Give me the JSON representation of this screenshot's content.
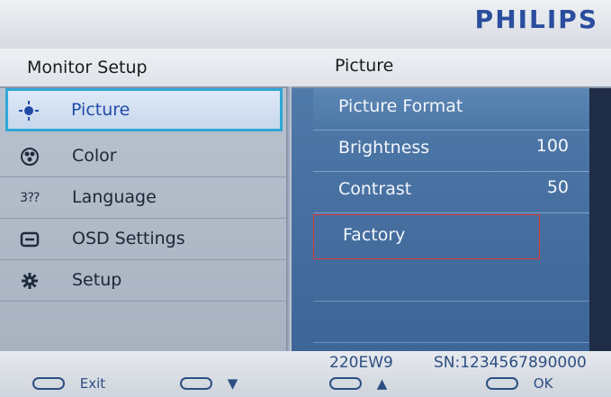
{
  "brand": "PHILIPS",
  "header": {
    "left_title": "Monitor Setup",
    "right_title": "Picture"
  },
  "menu": [
    {
      "label": "Picture",
      "icon": "picture-icon",
      "selected": true
    },
    {
      "label": "Color",
      "icon": "color-icon"
    },
    {
      "label": "Language",
      "icon": "language-icon"
    },
    {
      "label": "OSD Settings",
      "icon": "osd-icon"
    },
    {
      "label": "Setup",
      "icon": "setup-icon"
    }
  ],
  "submenu": [
    {
      "label": "Picture Format",
      "value": ""
    },
    {
      "label": "Brightness",
      "value": "100"
    },
    {
      "label": "Contrast",
      "value": "50"
    },
    {
      "label": "Factory",
      "value": ""
    }
  ],
  "footer": {
    "model": "220EW9",
    "serial": "SN:1234567890000",
    "exit_label": "Exit",
    "down_label": "▼",
    "up_label": "▲",
    "ok_label": "OK"
  },
  "colors": {
    "brand": "#2a4d9e",
    "selected_border": "#2fa8d8",
    "focus_border": "#e03a3a",
    "right_panel": "#4f79a8"
  }
}
